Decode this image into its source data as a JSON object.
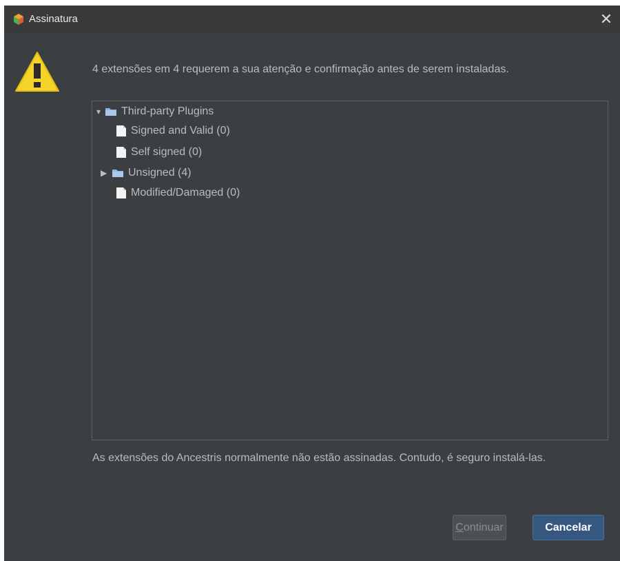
{
  "window": {
    "title": "Assinatura",
    "close_glyph": "✕",
    "app_icon": "ancestris-app-icon"
  },
  "message": "4 extensões em 4 requerem a sua atenção e confirmação antes de serem instaladas.",
  "warning_icon": "warning-triangle-icon",
  "tree": {
    "root": {
      "label": "Third-party Plugins",
      "expanded": true,
      "icon": "folder-icon"
    },
    "children": [
      {
        "label": "Signed and Valid (0)",
        "icon": "file-icon"
      },
      {
        "label": "Self signed (0)",
        "icon": "file-icon"
      },
      {
        "label": "Unsigned (4)",
        "icon": "folder-icon",
        "expanded": false
      },
      {
        "label": "Modified/Damaged (0)",
        "icon": "file-icon"
      }
    ]
  },
  "footnote": "As extensões do Ancestris normalmente não estão assinadas. Contudo, é seguro instalá-las.",
  "buttons": {
    "continue": {
      "mnemonic": "C",
      "rest": "ontinuar",
      "enabled": false
    },
    "cancel": {
      "label": "Cancelar"
    }
  },
  "colors": {
    "background": "#3c3f41",
    "titlebar": "#3a3a3a",
    "text": "#bbbbbb",
    "warning": "#f5d328",
    "folder": "#8fb7e0",
    "default_button": "#365880"
  }
}
